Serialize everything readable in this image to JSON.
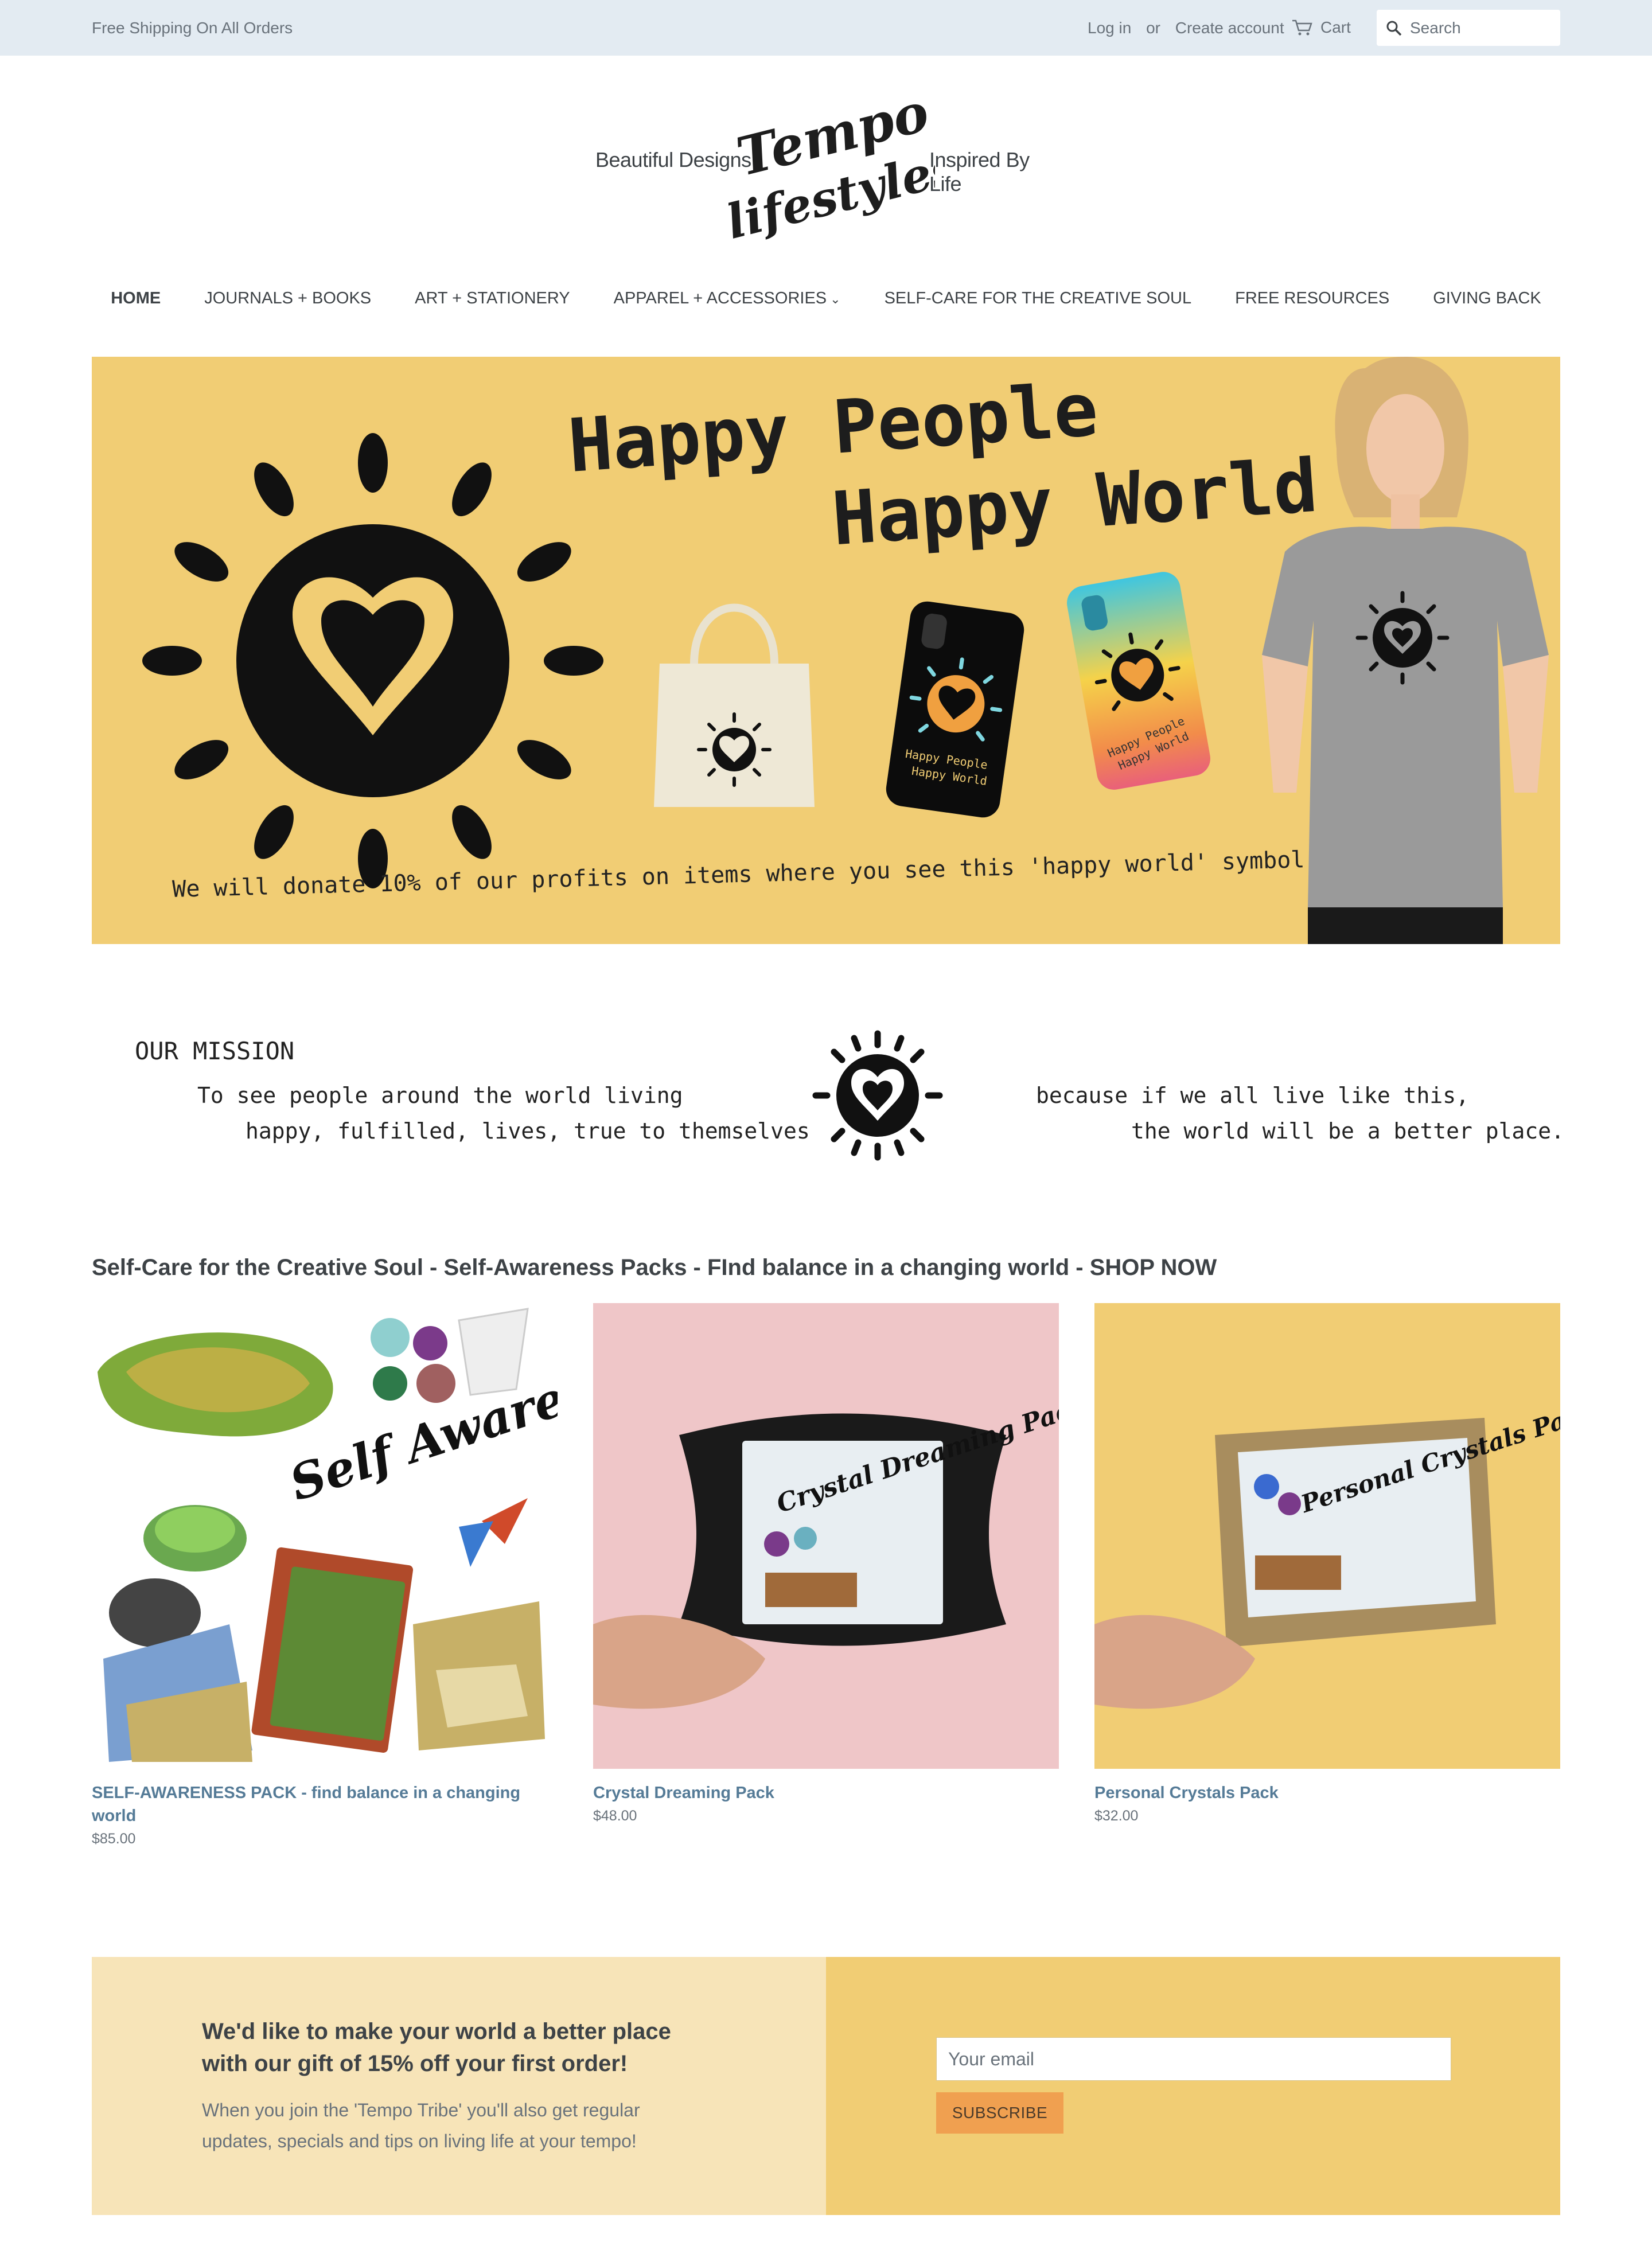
{
  "announcement": {
    "text": "Free Shipping On All Orders",
    "login": "Log in",
    "or": "or",
    "create_account": "Create account",
    "cart": "Cart",
    "search_placeholder": "Search"
  },
  "logo": {
    "tagline_left": "Beautiful Designs",
    "tagline_right": "Inspired By Life",
    "wordmark_top": "Tempo",
    "wordmark_bottom": "lifestyles"
  },
  "nav": {
    "items": [
      {
        "label": "HOME"
      },
      {
        "label": "JOURNALS + BOOKS"
      },
      {
        "label": "ART + STATIONERY"
      },
      {
        "label": "APPAREL + ACCESSORIES"
      },
      {
        "label": "SELF-CARE FOR THE CREATIVE SOUL"
      },
      {
        "label": "FREE RESOURCES"
      },
      {
        "label": "GIVING BACK"
      }
    ]
  },
  "hero": {
    "line1": "Happy People",
    "line2": "Happy World",
    "donate": "We will donate 10% of our profits on items where you see this 'happy world' symbol",
    "phone_text1": "Happy People",
    "phone_text2": "Happy World",
    "background_color": "#f1cd74"
  },
  "mission": {
    "title": "OUR MISSION",
    "line1": "To see people around the world living",
    "line2": "happy, fulfilled, lives, true to themselves",
    "line3": "because if we all live like this,",
    "line4": "the world will be a better place."
  },
  "collection": {
    "heading": "Self-Care for the Creative Soul - Self-Awareness Packs - FInd balance in a changing world - SHOP NOW",
    "products": [
      {
        "title": "SELF-AWARENESS PACK - find balance in a changing world",
        "price": "$85.00",
        "image_text": "Self Awareness Pack",
        "bg": "#ffffff"
      },
      {
        "title": "Crystal Dreaming Pack",
        "price": "$48.00",
        "image_text": "Crystal Dreaming Pack",
        "bg": "#efc6c8"
      },
      {
        "title": "Personal Crystals Pack",
        "price": "$32.00",
        "image_text": "Personal Crystals Pack",
        "bg": "#f1cd74"
      }
    ]
  },
  "newsletter": {
    "headline": "We'd like to make your world a better place with our gift of 15% off your first order!",
    "body": "When you join the 'Tempo Tribe' you'll also get regular updates, specials and tips on living life at your tempo!",
    "email_placeholder": "Your email",
    "subscribe": "SUBSCRIBE"
  },
  "colors": {
    "accent_link": "#557b97",
    "topbar_bg": "#e3ebf2",
    "subscribe_button": "#f0a050"
  }
}
